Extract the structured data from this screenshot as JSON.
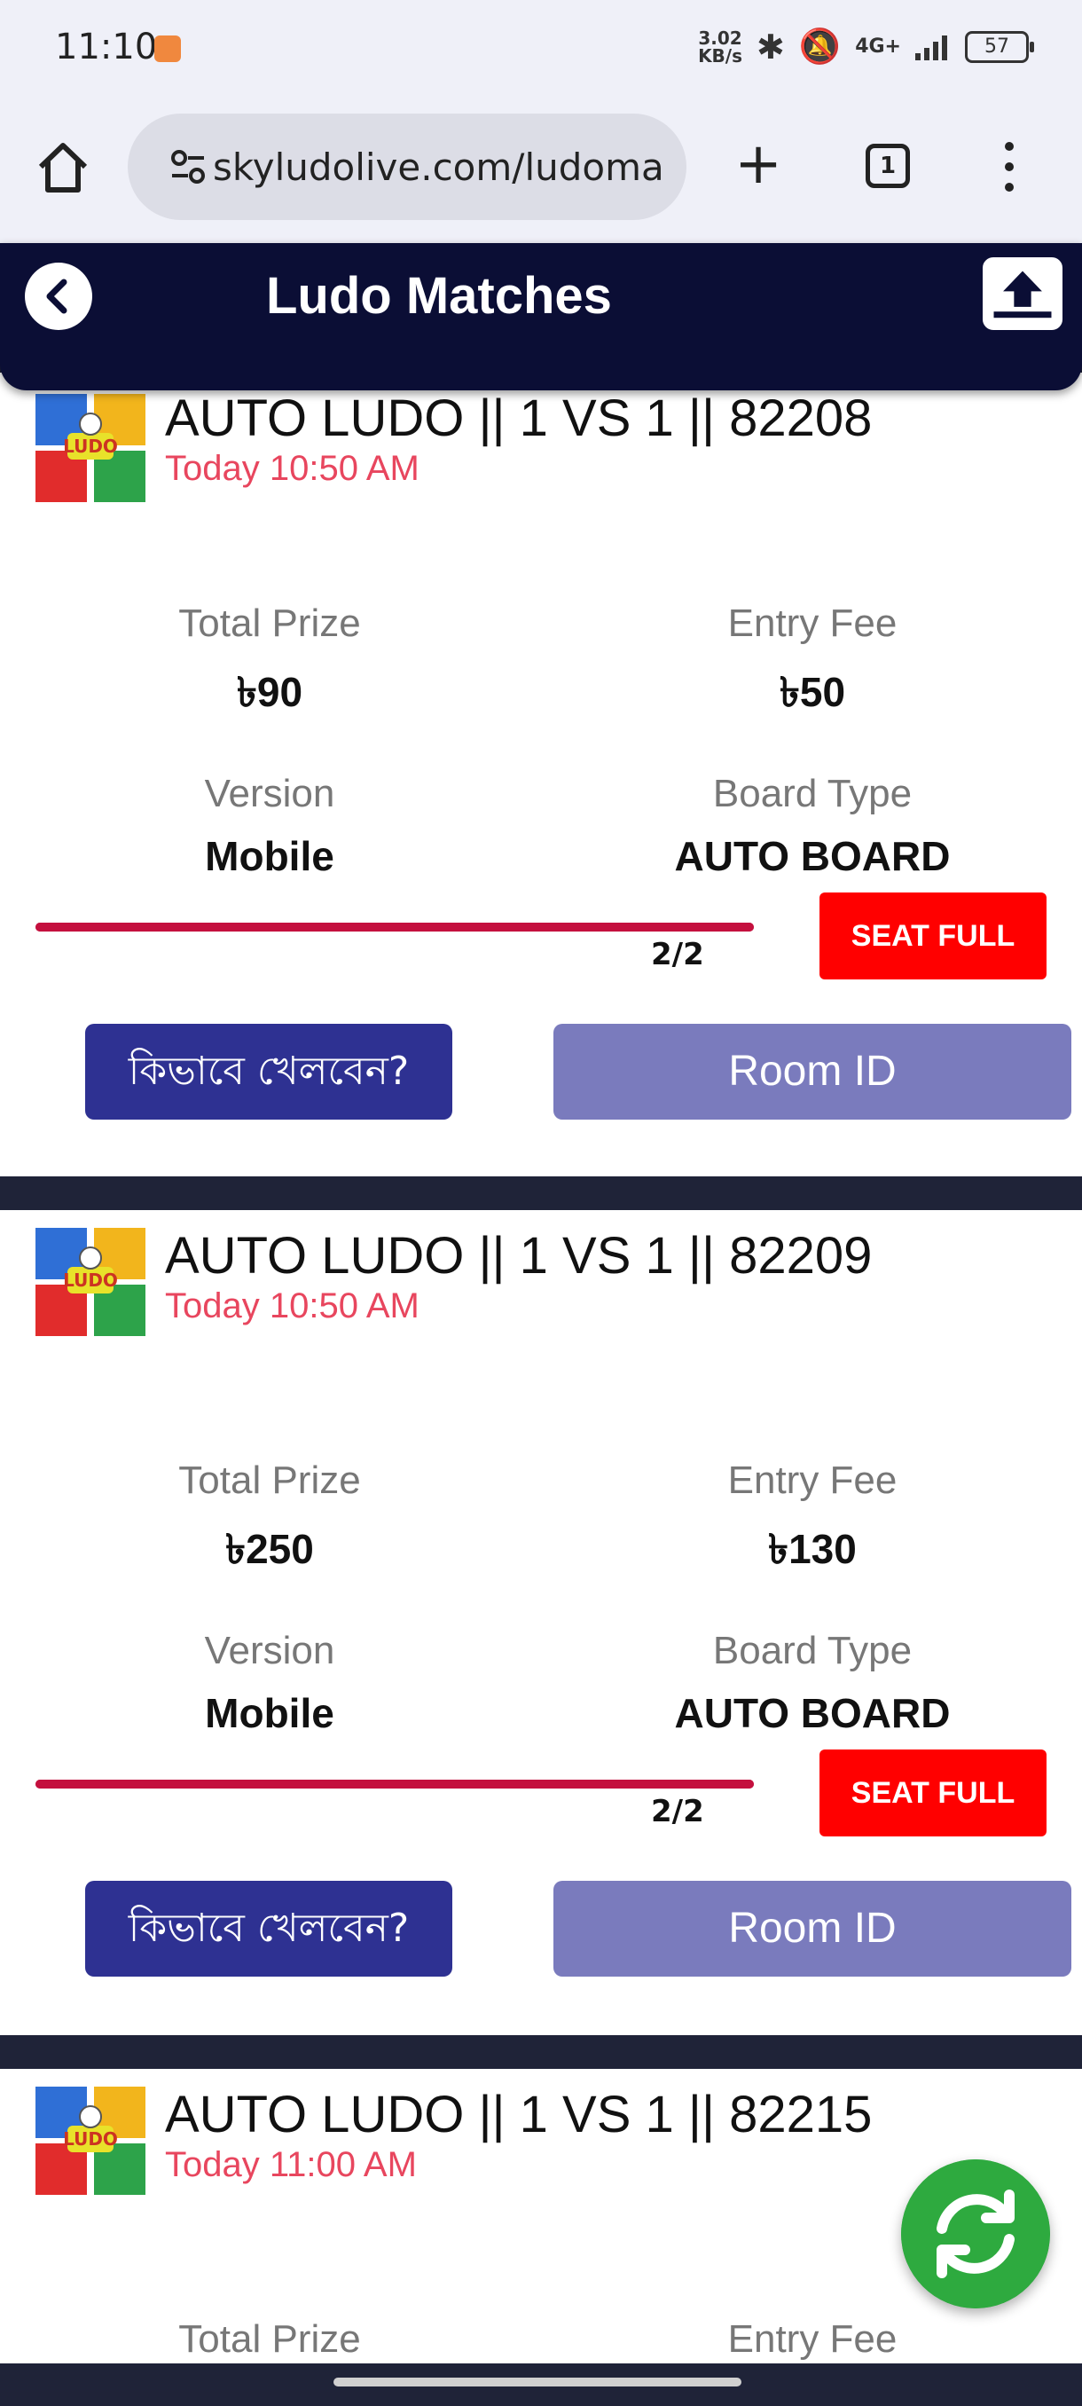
{
  "status_bar": {
    "time": "11:10",
    "net_speed_value": "3.02",
    "net_speed_unit": "KB/s",
    "network": "4G+",
    "battery": "57"
  },
  "browser": {
    "url": "skyludolive.com/ludoma",
    "tab_count": "1"
  },
  "header": {
    "title": "Ludo Matches"
  },
  "labels": {
    "total_prize": "Total Prize",
    "entry_fee": "Entry Fee",
    "version": "Version",
    "board_type": "Board Type",
    "how_to_play": "কিভাবে খেলবেন?",
    "room_id": "Room ID"
  },
  "matches": [
    {
      "title": "AUTO LUDO || 1 VS 1 || 82208",
      "time": "Today 10:50 AM",
      "total_prize": "৳90",
      "entry_fee": "৳50",
      "version": "Mobile",
      "board_type": "AUTO BOARD",
      "players": "2/2",
      "fill_fraction": 1.0,
      "status": "SEAT FULL"
    },
    {
      "title": "AUTO LUDO || 1 VS 1 || 82209",
      "time": "Today 10:50 AM",
      "total_prize": "৳250",
      "entry_fee": "৳130",
      "version": "Mobile",
      "board_type": "AUTO BOARD",
      "players": "2/2",
      "fill_fraction": 1.0,
      "status": "SEAT FULL"
    },
    {
      "title": "AUTO LUDO || 1 VS 1 || 82215",
      "time": "Today 11:00 AM"
    }
  ],
  "colors": {
    "header_bg": "#0b0e35",
    "time_text": "#e8465e",
    "progress": "#c4103e",
    "seat_full": "#ff0000",
    "how_to_btn": "#2e3192",
    "room_btn": "#7a7bbd",
    "refresh_fab": "#2eaa3f"
  },
  "icons": {
    "back": "chevron-left-icon",
    "upload": "upload-icon",
    "refresh": "refresh-icon",
    "home": "home-icon",
    "logo": "ludo-logo-icon"
  }
}
